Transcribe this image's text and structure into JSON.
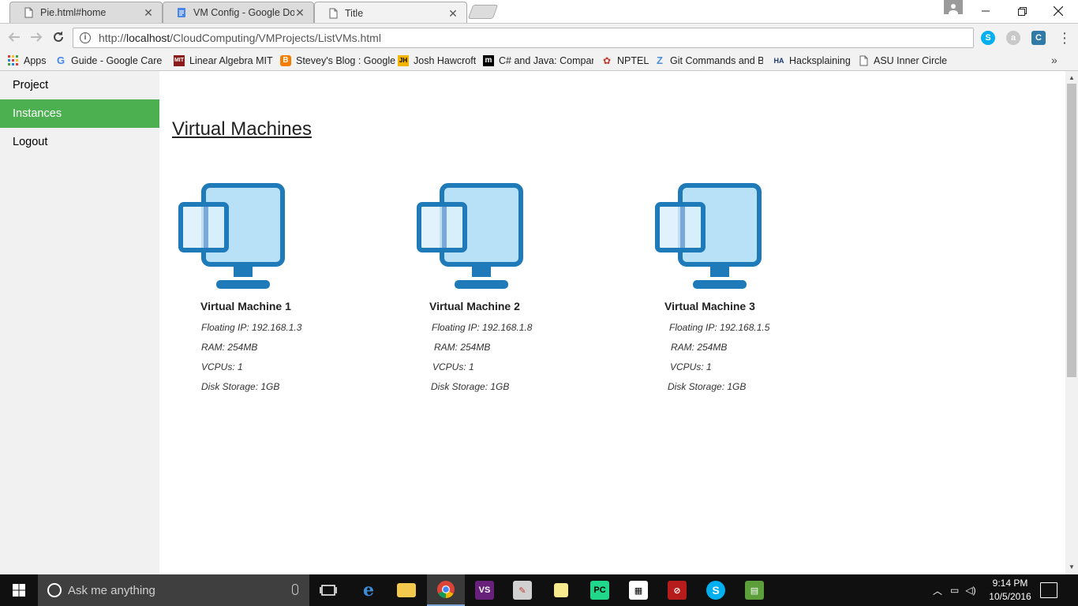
{
  "browser": {
    "tabs": [
      {
        "title": "Pie.html#home",
        "icon": "page-icon"
      },
      {
        "title": "VM Config - Google Doc",
        "icon": "google-docs-icon"
      },
      {
        "title": "Title",
        "icon": "page-icon"
      }
    ],
    "url": {
      "prefix": "http://",
      "host": "localhost",
      "path": "/CloudComputing/VMProjects/ListVMs.html"
    },
    "bookmarks": [
      {
        "label": "Apps",
        "icon": "apps-grid-icon"
      },
      {
        "label": "Guide - Google Caree",
        "icon": "google-icon"
      },
      {
        "label": "Linear Algebra MIT",
        "icon": "mit-ocw-icon"
      },
      {
        "label": "Stevey's Blog : Google",
        "icon": "blogger-icon"
      },
      {
        "label": "Josh Hawcroft",
        "icon": "jh-icon"
      },
      {
        "label": "C# and Java: Compari",
        "icon": "m-icon"
      },
      {
        "label": "NPTEL",
        "icon": "nptel-icon"
      },
      {
        "label": "Git Commands and Be",
        "icon": "z-icon"
      },
      {
        "label": "Hacksplaining",
        "icon": "ha-icon"
      },
      {
        "label": "ASU Inner Circle",
        "icon": "page-icon"
      }
    ]
  },
  "sidebar": {
    "items": [
      {
        "label": "Project",
        "active": false
      },
      {
        "label": "Instances",
        "active": true
      },
      {
        "label": "Logout",
        "active": false
      }
    ]
  },
  "main": {
    "heading": "Virtual Machines",
    "vms": [
      {
        "name": "Virtual Machine 1",
        "floating_ip": "Floating IP: 192.168.1.3",
        "ram": "RAM: 254MB",
        "vcpus": "VCPUs: 1",
        "disk": "Disk Storage: 1GB"
      },
      {
        "name": "Virtual Machine 2",
        "floating_ip": "Floating IP: 192.168.1.8",
        "ram": "RAM: 254MB",
        "vcpus": "VCPUs: 1",
        "disk": "Disk Storage: 1GB"
      },
      {
        "name": "Virtual Machine 3",
        "floating_ip": "Floating IP: 192.168.1.5",
        "ram": "RAM: 254MB",
        "vcpus": "VCPUs: 1",
        "disk": "Disk Storage: 1GB"
      }
    ]
  },
  "taskbar": {
    "search_placeholder": "Ask me anything",
    "time": "9:14 PM",
    "date": "10/5/2016"
  },
  "colors": {
    "sidebar_active": "#4caf50",
    "vm_icon_frame": "#1e7ab8",
    "vm_icon_fill": "#b8e0f7"
  }
}
